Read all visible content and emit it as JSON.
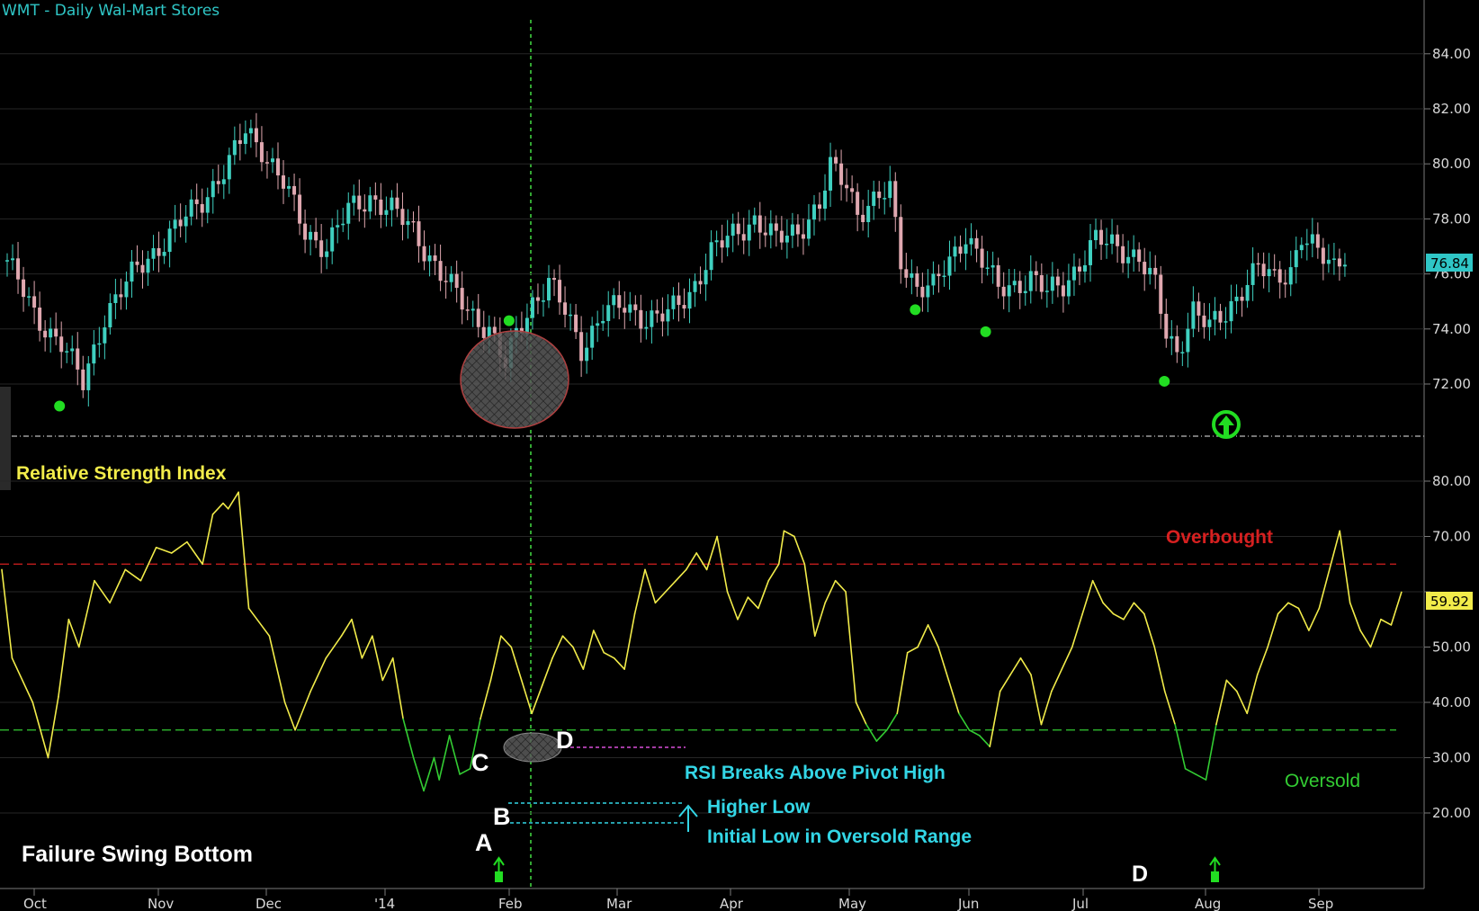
{
  "header": {
    "title": "WMT - Daily  Wal-Mart Stores"
  },
  "price_panel": {
    "last_value": "76.84",
    "ticks": [
      {
        "value": 84,
        "label": "84.00"
      },
      {
        "value": 82,
        "label": "82.00"
      },
      {
        "value": 80,
        "label": "80.00"
      },
      {
        "value": 78,
        "label": "78.00"
      },
      {
        "value": 76,
        "label": "76.00"
      },
      {
        "value": 74,
        "label": "74.00"
      },
      {
        "value": 72,
        "label": "72.00"
      }
    ]
  },
  "rsi_panel": {
    "title": "Relative Strength Index",
    "last_value": "59.92",
    "ticks": [
      {
        "value": 80,
        "label": "80.00"
      },
      {
        "value": 70,
        "label": "70.00"
      },
      {
        "value": 60,
        "label": "60.00"
      },
      {
        "value": 50,
        "label": "50.00"
      },
      {
        "value": 40,
        "label": "40.00"
      },
      {
        "value": 30,
        "label": "30.00"
      },
      {
        "value": 20,
        "label": "20.00"
      }
    ],
    "overbought_label": "Overbought",
    "oversold_label": "Oversold"
  },
  "annotations": {
    "pattern_name": "Failure Swing Bottom",
    "point_a": "A",
    "point_b": "B",
    "point_c": "C",
    "point_d": "D",
    "point_d_axis": "D",
    "breaks_above": "RSI Breaks Above Pivot High",
    "higher_low": "Higher Low",
    "initial_low": "Initial Low in Oversold Range"
  },
  "months": [
    "Oct",
    "Nov",
    "Dec",
    "'14",
    "Feb",
    "Mar",
    "Apr",
    "May",
    "Jun",
    "Jul",
    "Aug",
    "Sep"
  ],
  "colors": {
    "background": "#000000",
    "up_candle": "#3fd0c0",
    "down_candle": "#e0a8b0",
    "rsi_line": "#f2ec4a",
    "rsi_oversold_line": "#33cc33",
    "overbought": "#d62020",
    "oversold": "#33cc33",
    "marker": "#22dd22",
    "annotation_cyan": "#33d6e6",
    "pivot_line": "#d94fd9",
    "last_price_bg": "#2fc6c6",
    "last_rsi_bg": "#f2ec4a"
  },
  "chart_data": [
    {
      "type": "candlestick",
      "title": "WMT - Daily  Wal-Mart Stores",
      "ylim": [
        70.8,
        85.5
      ],
      "x_months": [
        "Oct",
        "Nov",
        "Dec",
        "'14",
        "Feb",
        "Mar",
        "Apr",
        "May",
        "Jun",
        "Jul",
        "Aug",
        "Sep"
      ],
      "last": 76.84,
      "close_path": [
        [
          0,
          76.5
        ],
        [
          5,
          74.5
        ],
        [
          10,
          73.5
        ],
        [
          14,
          72.0
        ],
        [
          18,
          74.5
        ],
        [
          24,
          76.2
        ],
        [
          30,
          77.4
        ],
        [
          36,
          78.7
        ],
        [
          41,
          80.0
        ],
        [
          44,
          81.2
        ],
        [
          47,
          80.6
        ],
        [
          51,
          79.3
        ],
        [
          55,
          77.5
        ],
        [
          59,
          77.0
        ],
        [
          63,
          78.3
        ],
        [
          67,
          78.8
        ],
        [
          71,
          78.3
        ],
        [
          75,
          77.6
        ],
        [
          80,
          76.0
        ],
        [
          85,
          74.7
        ],
        [
          89,
          74.0
        ],
        [
          92,
          72.6
        ],
        [
          94,
          73.8
        ],
        [
          97,
          75.0
        ],
        [
          100,
          75.7
        ],
        [
          103,
          74.6
        ],
        [
          106,
          73.3
        ],
        [
          110,
          74.6
        ],
        [
          114,
          74.8
        ],
        [
          118,
          74.4
        ],
        [
          122,
          74.5
        ],
        [
          126,
          75.3
        ],
        [
          130,
          76.8
        ],
        [
          134,
          77.4
        ],
        [
          138,
          78.0
        ],
        [
          142,
          77.2
        ],
        [
          146,
          77.6
        ],
        [
          150,
          78.5
        ],
        [
          152,
          79.8
        ],
        [
          155,
          79.3
        ],
        [
          157,
          78.3
        ],
        [
          160,
          78.6
        ],
        [
          163,
          79.0
        ],
        [
          165,
          76.5
        ],
        [
          168,
          75.6
        ],
        [
          171,
          75.5
        ],
        [
          174,
          76.4
        ],
        [
          177,
          77.5
        ],
        [
          180,
          76.5
        ],
        [
          183,
          75.4
        ],
        [
          186,
          75.6
        ],
        [
          189,
          75.9
        ],
        [
          192,
          75.3
        ],
        [
          195,
          75.6
        ],
        [
          198,
          76.4
        ],
        [
          201,
          77.2
        ],
        [
          205,
          77.0
        ],
        [
          209,
          76.6
        ],
        [
          212,
          75.5
        ],
        [
          214,
          73.8
        ],
        [
          216,
          73.2
        ],
        [
          219,
          74.7
        ],
        [
          222,
          74.0
        ],
        [
          225,
          74.6
        ],
        [
          228,
          75.5
        ],
        [
          231,
          76.2
        ],
        [
          234,
          75.8
        ],
        [
          237,
          76.2
        ],
        [
          239,
          77.4
        ],
        [
          242,
          76.7
        ],
        [
          245,
          76.3
        ],
        [
          247,
          76.84
        ]
      ],
      "swing_low_markers": [
        71.2,
        74.3,
        74.7,
        73.9,
        72.1
      ]
    },
    {
      "type": "line",
      "title": "Relative Strength Index",
      "ylim": [
        15,
        86
      ],
      "overbought": 65,
      "oversold": 35,
      "last": 59.92,
      "series": [
        {
          "values": [
            [
              0,
              64
            ],
            [
              2,
              48
            ],
            [
              6,
              40
            ],
            [
              9,
              30
            ],
            [
              11,
              41
            ],
            [
              13,
              55
            ],
            [
              15,
              50
            ],
            [
              18,
              62
            ],
            [
              21,
              58
            ],
            [
              24,
              64
            ],
            [
              27,
              62
            ],
            [
              30,
              68
            ],
            [
              33,
              67
            ],
            [
              36,
              69
            ],
            [
              39,
              65
            ],
            [
              41,
              74
            ],
            [
              43,
              76
            ],
            [
              44,
              75
            ],
            [
              46,
              78
            ],
            [
              48,
              57
            ],
            [
              52,
              52
            ],
            [
              55,
              40
            ],
            [
              57,
              35
            ],
            [
              60,
              42
            ],
            [
              63,
              48
            ],
            [
              66,
              52
            ],
            [
              68,
              55
            ],
            [
              70,
              48
            ],
            [
              72,
              52
            ],
            [
              74,
              44
            ],
            [
              76,
              48
            ],
            [
              78,
              37
            ],
            [
              80,
              30
            ],
            [
              82,
              24
            ],
            [
              84,
              30
            ],
            [
              85,
              26
            ],
            [
              87,
              34
            ],
            [
              89,
              27
            ],
            [
              91,
              28
            ],
            [
              93,
              37
            ],
            [
              95,
              44
            ],
            [
              97,
              52
            ],
            [
              99,
              50
            ],
            [
              101,
              44
            ],
            [
              103,
              38
            ],
            [
              105,
              43
            ],
            [
              107,
              48
            ],
            [
              109,
              52
            ],
            [
              111,
              50
            ],
            [
              113,
              46
            ],
            [
              115,
              53
            ],
            [
              117,
              49
            ],
            [
              119,
              48
            ],
            [
              121,
              46
            ],
            [
              123,
              56
            ],
            [
              125,
              64
            ],
            [
              127,
              58
            ],
            [
              129,
              60
            ],
            [
              131,
              62
            ],
            [
              133,
              64
            ],
            [
              135,
              67
            ],
            [
              137,
              64
            ],
            [
              139,
              70
            ],
            [
              141,
              60
            ],
            [
              143,
              55
            ],
            [
              145,
              59
            ],
            [
              147,
              57
            ],
            [
              149,
              62
            ],
            [
              151,
              65
            ],
            [
              152,
              71
            ],
            [
              154,
              70
            ],
            [
              156,
              65
            ],
            [
              158,
              52
            ],
            [
              160,
              58
            ],
            [
              162,
              62
            ],
            [
              164,
              60
            ],
            [
              166,
              40
            ],
            [
              168,
              36
            ],
            [
              170,
              33
            ],
            [
              172,
              35
            ],
            [
              174,
              38
            ],
            [
              176,
              49
            ],
            [
              178,
              50
            ],
            [
              180,
              54
            ],
            [
              182,
              50
            ],
            [
              184,
              44
            ],
            [
              186,
              38
            ],
            [
              188,
              35
            ],
            [
              190,
              34
            ],
            [
              192,
              32
            ],
            [
              194,
              42
            ],
            [
              196,
              45
            ],
            [
              198,
              48
            ],
            [
              200,
              45
            ],
            [
              202,
              36
            ],
            [
              204,
              42
            ],
            [
              206,
              46
            ],
            [
              208,
              50
            ],
            [
              210,
              56
            ],
            [
              212,
              62
            ],
            [
              214,
              58
            ],
            [
              216,
              56
            ],
            [
              218,
              55
            ],
            [
              220,
              58
            ],
            [
              222,
              56
            ],
            [
              224,
              50
            ],
            [
              226,
              42
            ],
            [
              228,
              36
            ],
            [
              230,
              28
            ],
            [
              232,
              27
            ],
            [
              234,
              26
            ],
            [
              236,
              36
            ],
            [
              238,
              44
            ],
            [
              240,
              42
            ],
            [
              242,
              38
            ],
            [
              244,
              45
            ],
            [
              246,
              50
            ],
            [
              248,
              56
            ],
            [
              250,
              58
            ],
            [
              252,
              57
            ],
            [
              254,
              53
            ],
            [
              256,
              57
            ],
            [
              258,
              64
            ],
            [
              260,
              71
            ],
            [
              262,
              58
            ],
            [
              264,
              53
            ],
            [
              266,
              50
            ],
            [
              268,
              55
            ],
            [
              270,
              54
            ],
            [
              272,
              59.92
            ]
          ]
        }
      ]
    }
  ]
}
